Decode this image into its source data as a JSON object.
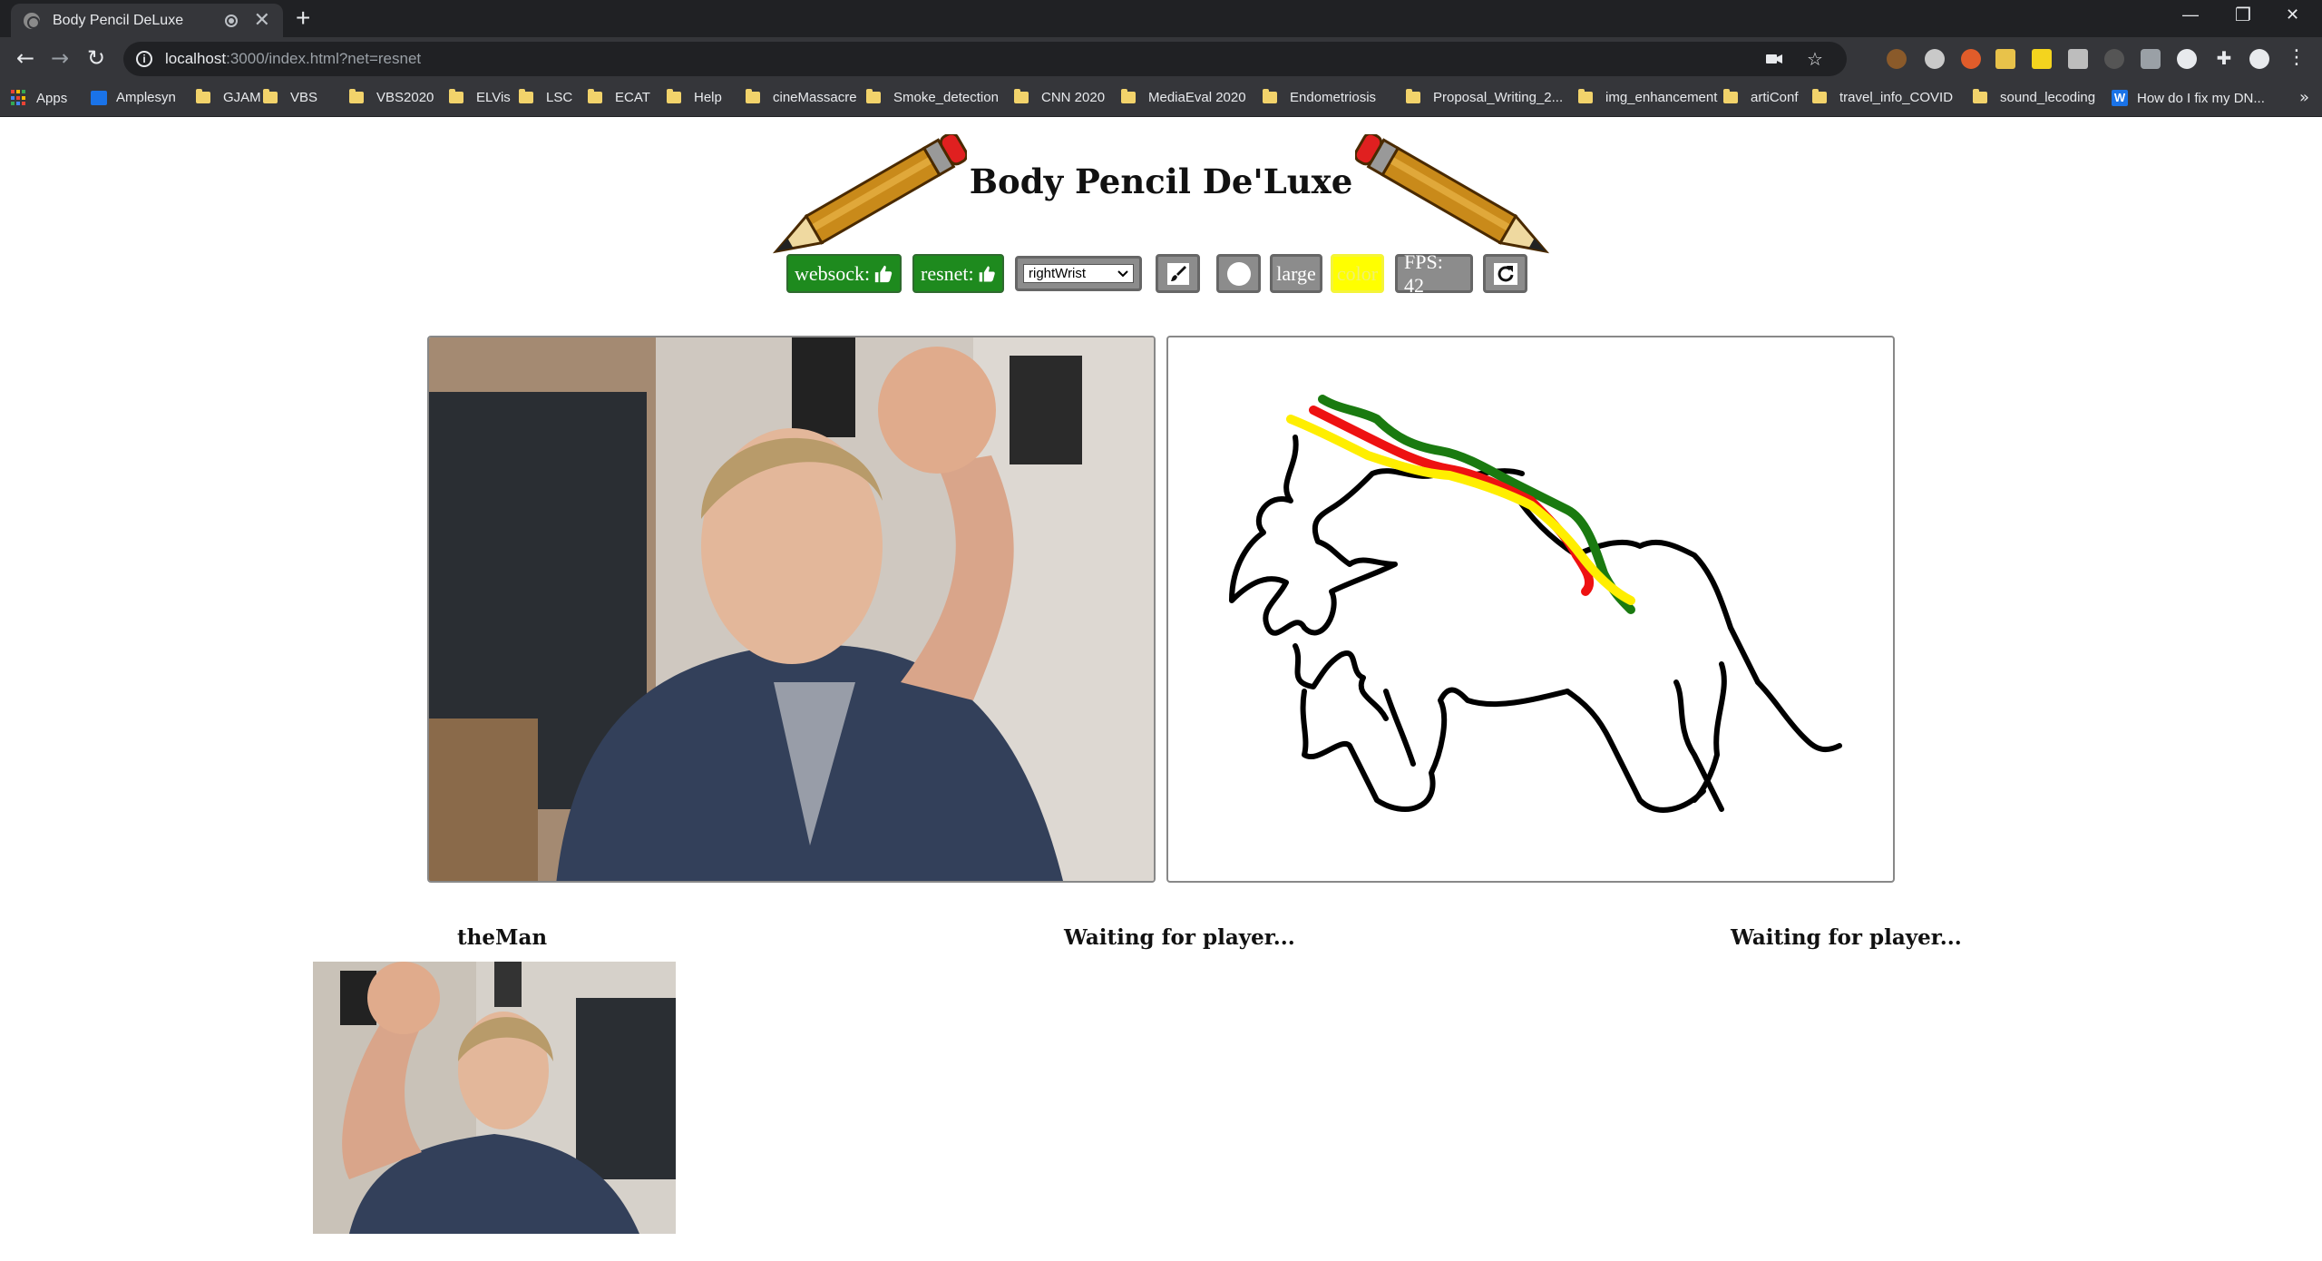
{
  "browser": {
    "tab_title": "Body Pencil DeLuxe",
    "new_tab": "+",
    "url_host": "localhost",
    "url_rest": ":3000/index.html?net=resnet",
    "window_controls": [
      "minimize-icon",
      "restore-icon",
      "close-icon"
    ],
    "bookmarks": [
      {
        "label": "Apps",
        "icon": "apps-grid-icon"
      },
      {
        "label": "Amplesyn",
        "icon": "badge-icon"
      },
      {
        "label": "GJAM",
        "icon": "folder-icon"
      },
      {
        "label": "VBS",
        "icon": "folder-icon"
      },
      {
        "label": "VBS2020",
        "icon": "folder-icon"
      },
      {
        "label": "ELVis",
        "icon": "folder-icon"
      },
      {
        "label": "LSC",
        "icon": "folder-icon"
      },
      {
        "label": "ECAT",
        "icon": "folder-icon"
      },
      {
        "label": "Help",
        "icon": "folder-icon"
      },
      {
        "label": "cineMassacre",
        "icon": "folder-icon"
      },
      {
        "label": "Smoke_detection",
        "icon": "folder-icon"
      },
      {
        "label": "CNN 2020",
        "icon": "folder-icon"
      },
      {
        "label": "MediaEval 2020",
        "icon": "folder-icon"
      },
      {
        "label": "Endometriosis",
        "icon": "folder-icon"
      },
      {
        "label": "Proposal_Writing_2...",
        "icon": "folder-icon"
      },
      {
        "label": "img_enhancement",
        "icon": "folder-icon"
      },
      {
        "label": "artiConf",
        "icon": "folder-icon"
      },
      {
        "label": "travel_info_COVID",
        "icon": "folder-icon"
      },
      {
        "label": "sound_lecoding",
        "icon": "folder-icon"
      },
      {
        "label": "How do I fix my DN...",
        "icon": "w-icon"
      }
    ],
    "bookmarks_more": "»"
  },
  "app": {
    "title": "Body Pencil De'Luxe",
    "controls": {
      "websock_label": "websock:",
      "resnet_label": "resnet:",
      "keypoint_selected": "rightWrist",
      "size_label": "large",
      "color_label": "color",
      "color_value": "#ffff00",
      "fps_label": "FPS: 42"
    },
    "players": [
      {
        "name": "theMan"
      },
      {
        "name": "Waiting for player..."
      },
      {
        "name": "Waiting for player..."
      }
    ],
    "stroke_colors": {
      "outline": "#000000",
      "green": "#1a7a10",
      "red": "#ee1111",
      "yellow": "#ffee00"
    }
  }
}
